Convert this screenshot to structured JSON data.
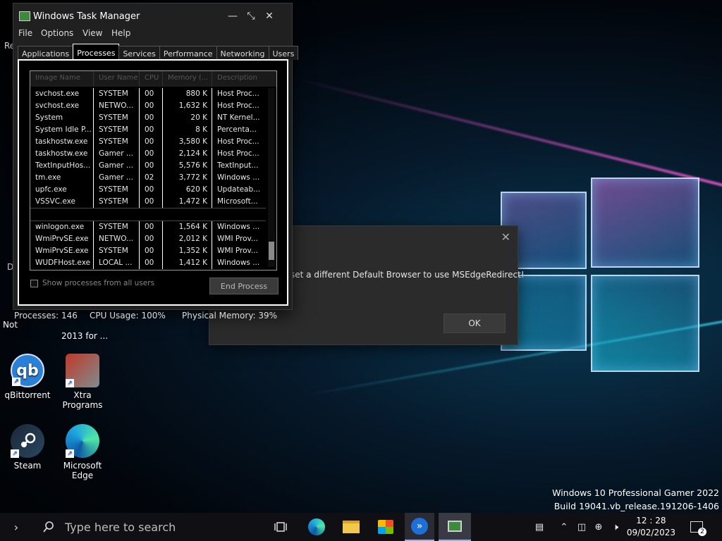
{
  "task_manager": {
    "title": "Windows Task Manager",
    "menu": [
      "File",
      "Options",
      "View",
      "Help"
    ],
    "tabs": [
      "Applications",
      "Processes",
      "Services",
      "Performance",
      "Networking",
      "Users"
    ],
    "active_tab": "Processes",
    "columns": [
      "Image Name",
      "User Name",
      "CPU",
      "Memory (...",
      "Description"
    ],
    "rows": [
      {
        "name": "svchost.exe",
        "user": "SYSTEM",
        "cpu": "00",
        "mem": "880 K",
        "desc": "Host Proc..."
      },
      {
        "name": "svchost.exe",
        "user": "NETWO...",
        "cpu": "00",
        "mem": "1,632 K",
        "desc": "Host Proc..."
      },
      {
        "name": "System",
        "user": "SYSTEM",
        "cpu": "00",
        "mem": "20 K",
        "desc": "NT Kernel..."
      },
      {
        "name": "System Idle P...",
        "user": "SYSTEM",
        "cpu": "00",
        "mem": "8 K",
        "desc": "Percenta..."
      },
      {
        "name": "taskhostw.exe",
        "user": "SYSTEM",
        "cpu": "00",
        "mem": "3,580 K",
        "desc": "Host Proc..."
      },
      {
        "name": "taskhostw.exe",
        "user": "Gamer ...",
        "cpu": "00",
        "mem": "2,124 K",
        "desc": "Host Proc..."
      },
      {
        "name": "TextInputHos...",
        "user": "Gamer ...",
        "cpu": "00",
        "mem": "5,576 K",
        "desc": "TextInput..."
      },
      {
        "name": "tm.exe",
        "user": "Gamer ...",
        "cpu": "02",
        "mem": "3,772 K",
        "desc": "Windows ..."
      },
      {
        "name": "upfc.exe",
        "user": "SYSTEM",
        "cpu": "00",
        "mem": "620 K",
        "desc": "Updateab..."
      },
      {
        "name": "VSSVC.exe",
        "user": "SYSTEM",
        "cpu": "00",
        "mem": "1,472 K",
        "desc": "Microsoft..."
      }
    ],
    "rows_after": [
      {
        "name": "winlogon.exe",
        "user": "SYSTEM",
        "cpu": "00",
        "mem": "1,564 K",
        "desc": "Windows ..."
      },
      {
        "name": "WmiPrvSE.exe",
        "user": "NETWO...",
        "cpu": "00",
        "mem": "2,012 K",
        "desc": "WMI Prov..."
      },
      {
        "name": "WmiPrvSE.exe",
        "user": "SYSTEM",
        "cpu": "00",
        "mem": "1,352 K",
        "desc": "WMI Prov..."
      },
      {
        "name": "WUDFHost.exe",
        "user": "LOCAL ...",
        "cpu": "00",
        "mem": "1,412 K",
        "desc": "Windows ..."
      }
    ],
    "show_all_label": "Show processes from all users",
    "end_process_label": "End Process",
    "status": {
      "processes": "Processes: 146",
      "cpu": "CPU Usage: 100%",
      "memory": "Physical Memory: 39%"
    }
  },
  "error_dialog": {
    "message": "set a different Default Browser to use MSEdgeRedirect!",
    "ok_label": "OK"
  },
  "desktop": {
    "partial_labels": {
      "top_left": "Re",
      "left_mid": "D",
      "notepad": "Not",
      "office": "2013 for ..."
    },
    "icons": [
      {
        "label": "qBittorrent"
      },
      {
        "label": "Xtra Programs"
      },
      {
        "label": "Steam"
      },
      {
        "label": "Microsoft Edge"
      }
    ]
  },
  "watermark": {
    "line1": "Windows 10 Professional Gamer 2022",
    "line2": "Build 19041.vb_release.191206-1406"
  },
  "taskbar": {
    "search_placeholder": "Type here to search",
    "time": "12 : 28",
    "date": "09/02/2023",
    "notification_count": "2"
  }
}
